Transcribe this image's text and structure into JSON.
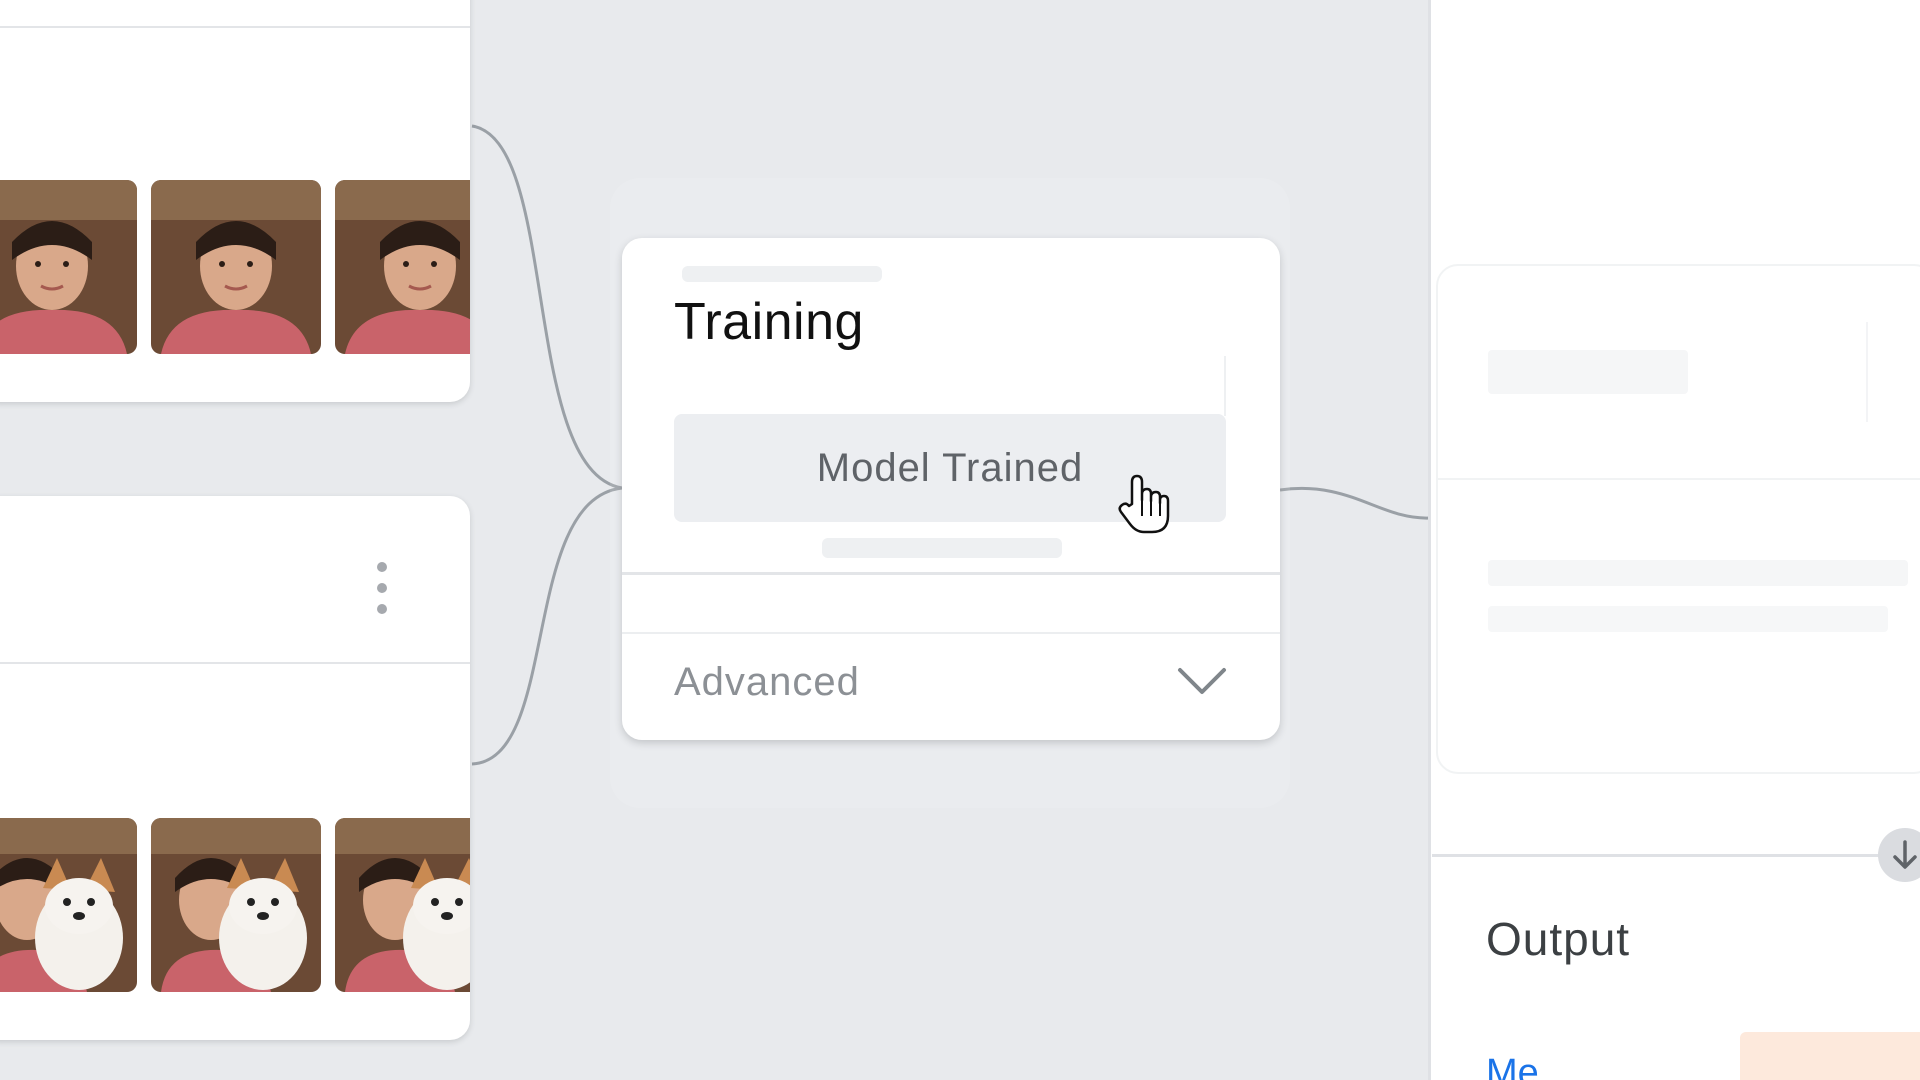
{
  "training": {
    "title": "Training",
    "train_button_label": "Model Trained",
    "advanced_label": "Advanced"
  },
  "preview": {
    "output_title": "Output",
    "output_class_1": "Me"
  },
  "colors": {
    "canvas_background": "#e8eaed",
    "panel": "#ffffff",
    "connector": "#9aa0a6",
    "link_blue": "#1a73e8",
    "confidence_bar": "#fde9dc"
  },
  "icons": [
    "kebab-menu-icon",
    "chevron-down-icon",
    "hand-pointer-icon",
    "arrow-down-icon"
  ]
}
